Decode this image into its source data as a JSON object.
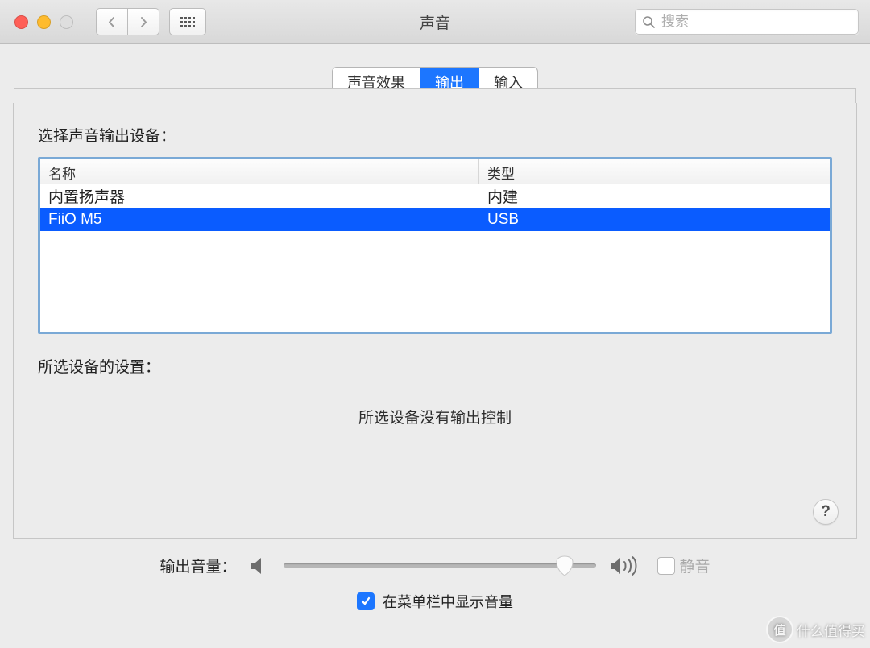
{
  "window": {
    "title": "声音",
    "search_placeholder": "搜索"
  },
  "tabs": {
    "effects": "声音效果",
    "output": "输出",
    "input": "输入",
    "active": "输出"
  },
  "output_panel": {
    "select_label": "选择声音输出设备：",
    "columns": {
      "name": "名称",
      "type": "类型"
    },
    "devices": [
      {
        "name": "内置扬声器",
        "type": "内建",
        "selected": false
      },
      {
        "name": "FiiO M5",
        "type": "USB",
        "selected": true
      }
    ],
    "settings_label": "所选设备的设置：",
    "settings_message": "所选设备没有输出控制"
  },
  "volume": {
    "label": "输出音量：",
    "value": 0.9,
    "mute_label": "静音",
    "mute_checked": false,
    "show_in_menubar_label": "在菜单栏中显示音量",
    "show_in_menubar_checked": true
  },
  "help_glyph": "?",
  "watermark": "什么值得买"
}
